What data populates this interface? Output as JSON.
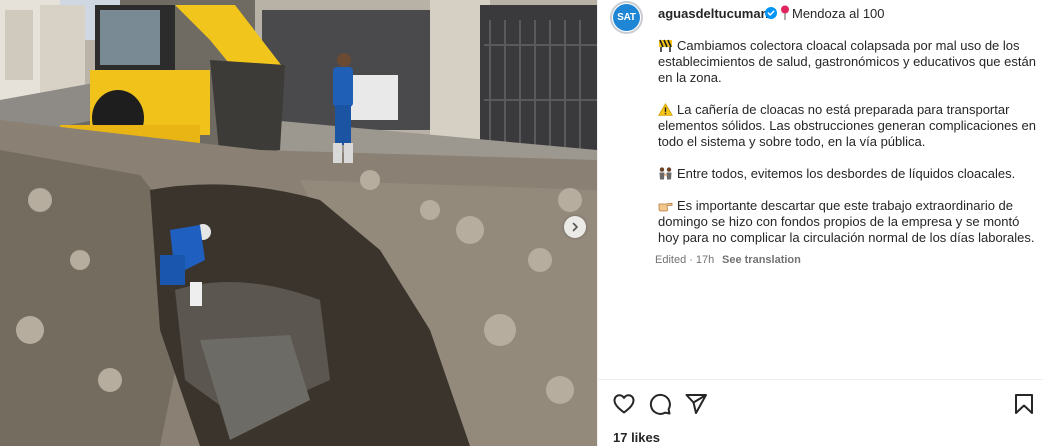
{
  "account": {
    "avatar_text": "SAT",
    "username": "aguasdeltucuman",
    "verified": true,
    "location": "Mendoza al 100"
  },
  "caption": {
    "paragraphs": [
      {
        "icon": "construction-sign-icon",
        "text": "Cambiamos colectora cloacal colapsada por mal uso de los establecimientos de salud, gastronómicos y educativos que están en la zona."
      },
      {
        "icon": "warning-icon",
        "text": "La cañería de cloacas no está preparada para transportar elementos sólidos. Las obstrucciones generan complicaciones en todo el sistema y sobre todo, en la vía pública."
      },
      {
        "icon": "people-holding-hands-icon",
        "text": "Entre todos, evitemos los desbordes de líquidos cloacales."
      },
      {
        "icon": "pointing-hand-icon",
        "text": "Es importante descartar que este trabajo extraordinario de domingo se hizo con fondos propios de la empresa y se montó hoy para no complicar la circulación normal de los días laborales."
      }
    ]
  },
  "meta": {
    "edited": "Edited",
    "separator": "·",
    "time": "17h",
    "translate": "See translation"
  },
  "engagement": {
    "likes": "17 likes"
  },
  "icons": {
    "like": "heart-outline-icon",
    "comment": "comment-bubble-icon",
    "share": "paper-plane-icon",
    "save": "bookmark-icon",
    "next": "chevron-right-icon"
  },
  "colors": {
    "avatar": "#1f86d6",
    "verified": "#0095f6",
    "text": "#262626",
    "muted": "#737373"
  }
}
